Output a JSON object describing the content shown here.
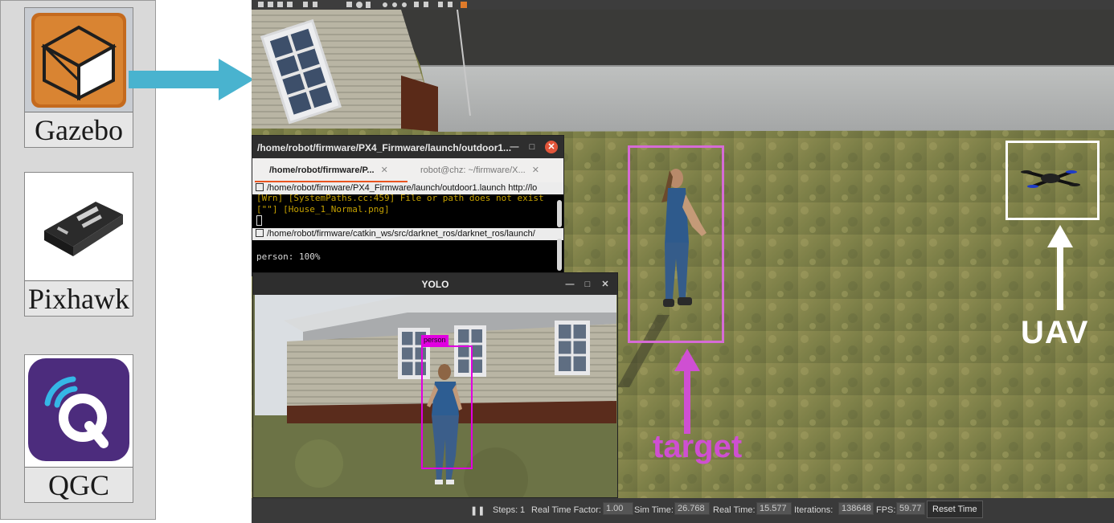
{
  "software_panel": {
    "items": [
      {
        "label": "Gazebo",
        "icon": "gazebo-logo-icon"
      },
      {
        "label": "Pixhawk",
        "icon": "pixhawk-board-icon"
      },
      {
        "label": "QGC",
        "icon": "qgc-logo-icon"
      }
    ]
  },
  "terminal": {
    "title": "/home/robot/firmware/PX4_Firmware/launch/outdoor1...",
    "tabs": [
      {
        "label": "/home/robot/firmware/P..."
      },
      {
        "label": "robot@chz: ~/firmware/X..."
      }
    ],
    "pane1": {
      "header": "/home/robot/firmware/PX4_Firmware/launch/outdoor1.launch http://lo",
      "lines": [
        "[Wrn] [SystemPaths.cc:459] File or path does not exist",
        "[\"\"] [House_1_Normal.png]"
      ]
    },
    "pane2": {
      "header": "/home/robot/firmware/catkin_ws/src/darknet_ros/darknet_ros/launch/",
      "lines": [
        "person: 100%"
      ]
    },
    "warn_color": "#c4a000"
  },
  "yolo": {
    "title": "YOLO",
    "detection_label": "person",
    "box_color": "#e100e1"
  },
  "statusbar": {
    "pause_icon": "pause-icon",
    "steps_label": "Steps:",
    "steps_value": "1",
    "rtf_label": "Real Time Factor:",
    "rtf_value": "1.00",
    "sim_time_label": "Sim Time:",
    "sim_time_value": "26.768",
    "real_time_label": "Real Time:",
    "real_time_value": "15.577",
    "iterations_label": "Iterations:",
    "iterations_value": "138648",
    "fps_label": "FPS:",
    "fps_value": "59.77",
    "reset_label": "Reset Time"
  },
  "annotations": {
    "target_label": "target",
    "uav_label": "UAV",
    "target_color": "#cf4fd2",
    "uav_color": "#ffffff"
  }
}
